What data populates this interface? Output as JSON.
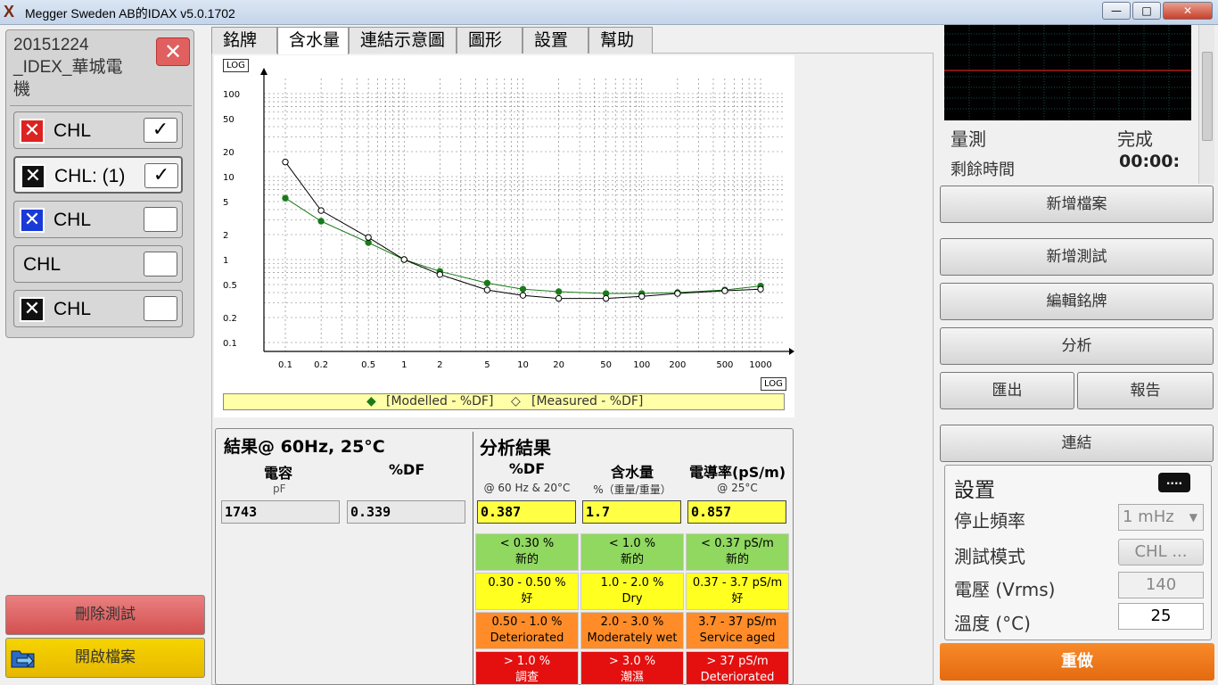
{
  "window": {
    "title": "Megger Sweden AB的IDAX v5.0.1702",
    "min_label": "—",
    "max_label": "□",
    "close_label": "✕"
  },
  "test": {
    "title_lines": [
      "20151224",
      "_IDEX_華城電",
      "機"
    ],
    "close_label": "✕"
  },
  "channels": [
    {
      "label": "CHL",
      "icon_color": "#dd2222",
      "icon_glyph": "✕",
      "checked": true,
      "check_glyph": "✓",
      "selected": false
    },
    {
      "label": "CHL: (1)",
      "icon_color": "#111111",
      "icon_glyph": "✕",
      "checked": true,
      "check_glyph": "✓",
      "selected": true
    },
    {
      "label": "CHL",
      "icon_color": "#1a3ad8",
      "icon_glyph": "✕",
      "checked": false,
      "check_glyph": "",
      "selected": false
    },
    {
      "label": "CHL",
      "icon_color": "",
      "icon_glyph": "",
      "checked": false,
      "check_glyph": "",
      "selected": false
    },
    {
      "label": "CHL",
      "icon_color": "#111111",
      "icon_glyph": "✕",
      "checked": false,
      "check_glyph": "",
      "selected": false
    }
  ],
  "left_buttons": {
    "delete_label": "刪除測試",
    "open_label": "開啟檔案"
  },
  "tabs": [
    "銘牌",
    "含水量",
    "連結示意圖",
    "圖形",
    "設置",
    "幫助"
  ],
  "active_tab": 1,
  "chart_data": {
    "type": "line",
    "x_scale": "log",
    "y_scale": "log",
    "xlim": [
      0.1,
      1000
    ],
    "ylim": [
      0.1,
      100
    ],
    "x_ticks": [
      "0.1",
      "0.2",
      "0.5",
      "1",
      "2",
      "5",
      "10",
      "20",
      "50",
      "100",
      "200",
      "500",
      "1000"
    ],
    "y_ticks": [
      "0.1",
      "0.2",
      "0.5",
      "1",
      "2",
      "5",
      "10",
      "20",
      "50",
      "100"
    ],
    "log_badge_label": "LOG",
    "series": [
      {
        "name": "[Modelled - %DF]",
        "marker": "filled",
        "color": "#1a7a1a",
        "x": [
          0.1,
          0.2,
          0.5,
          1,
          2,
          5,
          10,
          20,
          50,
          100,
          200,
          500,
          1000
        ],
        "y": [
          5.5,
          2.9,
          1.6,
          1.0,
          0.72,
          0.52,
          0.44,
          0.41,
          0.39,
          0.39,
          0.4,
          0.43,
          0.48
        ]
      },
      {
        "name": "[Measured - %DF]",
        "marker": "hollow",
        "color": "#000000",
        "x": [
          0.1,
          0.2,
          0.5,
          1,
          2,
          5,
          10,
          20,
          50,
          100,
          200,
          500,
          1000
        ],
        "y": [
          15,
          3.9,
          1.85,
          1.0,
          0.66,
          0.43,
          0.37,
          0.34,
          0.34,
          0.36,
          0.39,
          0.42,
          0.44
        ]
      }
    ]
  },
  "results": {
    "title": "結果@ 60Hz, 25°C",
    "capacitance_header": "電容",
    "capacitance_unit": "pF",
    "capacitance_value": "1743",
    "df_header": "%DF",
    "df_value": "0.339"
  },
  "analysis": {
    "title": "分析結果",
    "columns": [
      {
        "header": "%DF",
        "sub": "@ 60 Hz & 20°C",
        "value": "0.387"
      },
      {
        "header": "含水量",
        "sub": "%（重量/重量）",
        "value": "1.7"
      },
      {
        "header": "電導率(pS/m)",
        "sub": "@ 25°C",
        "value": "0.857"
      }
    ],
    "rows": [
      {
        "class": "c-green",
        "cells": [
          [
            "< 0.30 %",
            "新的"
          ],
          [
            "< 1.0 %",
            "新的"
          ],
          [
            "< 0.37 pS/m",
            "新的"
          ]
        ]
      },
      {
        "class": "c-yellow",
        "cells": [
          [
            "0.30 - 0.50 %",
            "好"
          ],
          [
            "1.0 - 2.0 %",
            "Dry"
          ],
          [
            "0.37 - 3.7 pS/m",
            "好"
          ]
        ]
      },
      {
        "class": "c-orange",
        "cells": [
          [
            "0.50 - 1.0 %",
            "Deteriorated"
          ],
          [
            "2.0 - 3.0 %",
            "Moderately wet"
          ],
          [
            "3.7 - 37 pS/m",
            "Service aged"
          ]
        ]
      },
      {
        "class": "c-red",
        "cells": [
          [
            "> 1.0 %",
            "調查"
          ],
          [
            "> 3.0 %",
            "潮濕"
          ],
          [
            "> 37 pS/m",
            "Deteriorated"
          ]
        ]
      }
    ]
  },
  "status": {
    "measure_label": "量測",
    "state": "完成",
    "remaining_label": "剩餘時間",
    "remaining_value": "00:00:"
  },
  "right_buttons": {
    "new_file": "新增檔案",
    "new_test": "新增測試",
    "edit_nameplate": "編輯銘牌",
    "analyze": "分析",
    "export": "匯出",
    "report": "報告",
    "connect": "連結",
    "redo": "重做"
  },
  "settings": {
    "title": "設置",
    "more_label": "....",
    "stop_freq_label": "停止頻率",
    "stop_freq_value": "1 mHz",
    "mode_label": "測試模式",
    "mode_value": "CHL ...",
    "voltage_label": "電壓 (Vrms)",
    "voltage_value": "140",
    "temp_label": "溫度 (°C)",
    "temp_value": "25"
  }
}
